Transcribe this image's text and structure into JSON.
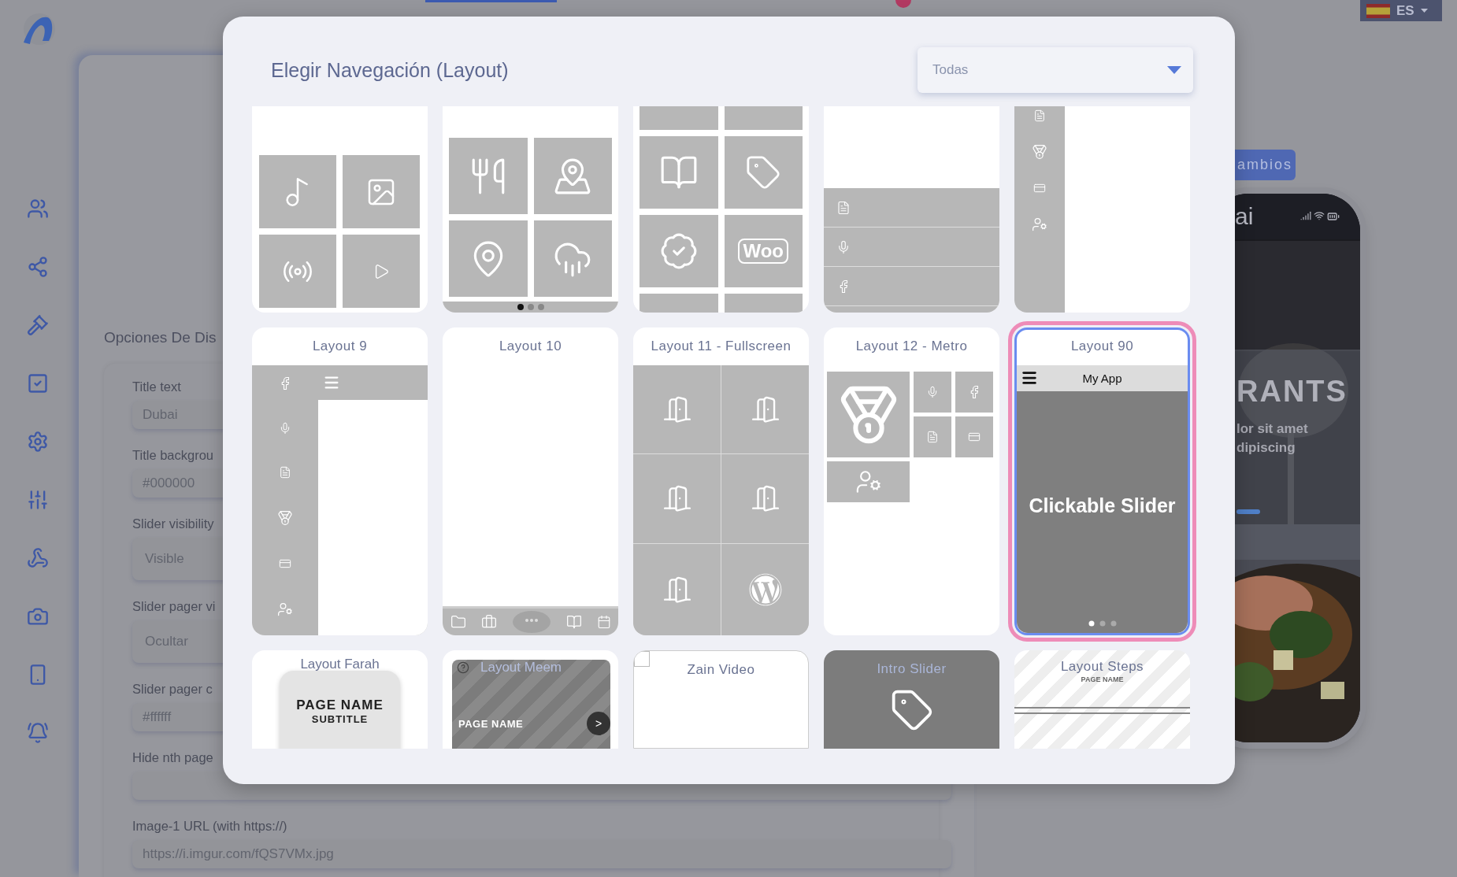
{
  "header": {
    "language": "ES"
  },
  "form": {
    "heading": "Opciones De Dis",
    "fields": [
      {
        "kind": "input",
        "label": "Title text",
        "value": "Dubai"
      },
      {
        "kind": "input",
        "label": "Title backgrou",
        "value": "#000000"
      },
      {
        "kind": "select",
        "label": "Slider visibility",
        "value": "Visible"
      },
      {
        "kind": "select",
        "label": "Slider pager vi",
        "value": "Ocultar"
      },
      {
        "kind": "input",
        "label": "Slider pager c",
        "value": "#ffffff"
      },
      {
        "kind": "wide",
        "label": "Hide nth page"
      },
      {
        "kind": "wide",
        "label": "Image-1 URL (with https://)",
        "value": "https://i.imgur.com/fQS7VMx.jpg"
      }
    ]
  },
  "preview": {
    "save_button": "ambios",
    "app_title": "ai",
    "headline": "RANTS",
    "lines": [
      "lor sit amet",
      "dipiscing"
    ]
  },
  "modal": {
    "title": "Elegir Navegación (Layout)",
    "filter": {
      "value": "Todas"
    },
    "cards": [
      {
        "kind": "media_grid",
        "selected": false
      },
      {
        "kind": "tile_pager",
        "selected": false
      },
      {
        "kind": "metro_scroll",
        "selected": false,
        "tile_label": "Woo"
      },
      {
        "kind": "bottom_list",
        "selected": false
      },
      {
        "kind": "narrow_sidebar",
        "selected": false
      },
      {
        "kind": "sidebar",
        "title": "Layout 9",
        "selected": false
      },
      {
        "kind": "tabbar",
        "title": "Layout 10",
        "selected": false
      },
      {
        "kind": "fullscreen",
        "title": "Layout 11 - Fullscreen",
        "selected": false
      },
      {
        "kind": "metro",
        "title": "Layout 12 - Metro",
        "selected": false
      },
      {
        "kind": "slider",
        "title": "Layout 90",
        "selected": true,
        "app_title": "My App",
        "slide_text": "Clickable Slider"
      },
      {
        "kind": "farah",
        "title": "Layout Farah",
        "selected": false,
        "page_name": "PAGE NAME",
        "subtitle": "SUBTITLE"
      },
      {
        "kind": "meem",
        "title": "Layout Meem",
        "selected": false,
        "page_name": "PAGE NAME",
        "button": ">"
      },
      {
        "kind": "video",
        "title": "Zain Video",
        "selected": false
      },
      {
        "kind": "intro",
        "title": "Intro Slider",
        "selected": false
      },
      {
        "kind": "steps",
        "title": "Layout Steps",
        "selected": false,
        "page_name": "PAGE NAME"
      }
    ]
  }
}
